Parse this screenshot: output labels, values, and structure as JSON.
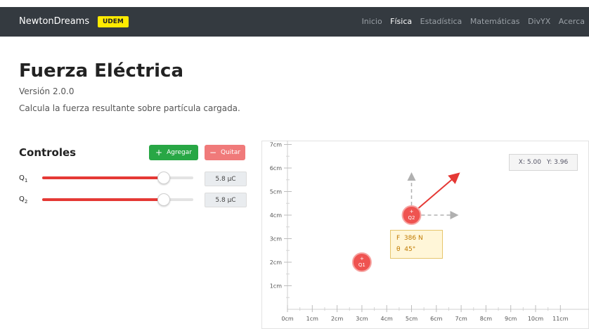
{
  "navbar": {
    "brand": "NewtonDreams",
    "badge": "UDEM",
    "links": [
      "Inicio",
      "Física",
      "Estadística",
      "Matemáticas",
      "DivYX",
      "Acerca"
    ],
    "active_link": "Física"
  },
  "header": {
    "title": "Fuerza Eléctrica",
    "version": "Versión 2.0.0",
    "description": "Calcula la fuerza resultante sobre partícula cargada."
  },
  "controls": {
    "title": "Controles",
    "add_label": "Agregar",
    "remove_label": "Quitar",
    "add_icon": "plus-icon",
    "remove_icon": "minus-icon",
    "charges": [
      {
        "label": "Q",
        "sub": "1",
        "value_text": "5.8 μC",
        "level": 0.8
      },
      {
        "label": "Q",
        "sub": "2",
        "value_text": "5.8 μC",
        "level": 0.8
      }
    ]
  },
  "plot": {
    "x_ticks": [
      "0cm",
      "1cm",
      "2cm",
      "3cm",
      "4cm",
      "5cm",
      "6cm",
      "7cm",
      "8cm",
      "9cm",
      "10cm",
      "11cm"
    ],
    "y_ticks": [
      "1cm",
      "2cm",
      "3cm",
      "4cm",
      "5cm",
      "6cm",
      "7cm"
    ],
    "coord_readout": {
      "x_label": "X:",
      "x_value": "5.00",
      "y_label": "Y:",
      "y_value": "3.96"
    },
    "particles": [
      {
        "name": "Q1",
        "sign": "+",
        "x": 3,
        "y": 2
      },
      {
        "name": "Q2",
        "sign": "+",
        "x": 5,
        "y": 4
      }
    ],
    "force": {
      "f_label": "F",
      "f_value": "386 N",
      "theta_label": "θ",
      "theta_value": "45°"
    },
    "colors": {
      "particle": "#ef5350",
      "force_arrow": "#e53935",
      "component_arrow": "#b0b0b0"
    }
  }
}
